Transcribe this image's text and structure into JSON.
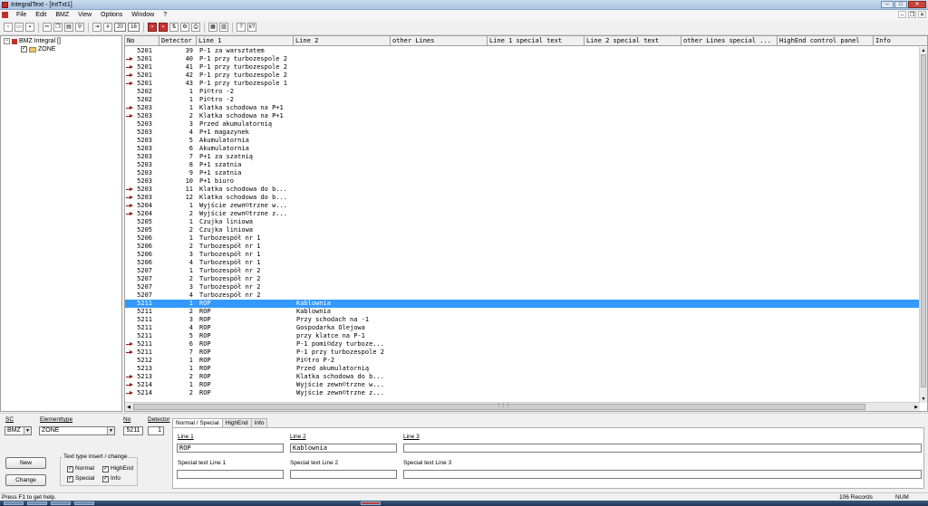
{
  "window": {
    "title": "IntegralText - [IntTxt1]"
  },
  "menu": [
    "File",
    "Edit",
    "BMZ",
    "View",
    "Options",
    "Window",
    "?"
  ],
  "toolbar": {
    "field1": "20",
    "field2": "16"
  },
  "tree": {
    "root": "BMZ Integral []",
    "child": "ZONE"
  },
  "grid": {
    "columns": [
      "No",
      "Detector",
      "Line 1",
      "Line 2",
      "other Lines",
      "Line 1 special text",
      "Line 2 special text",
      "other Lines special ...",
      "HighEnd control panel",
      "Info"
    ],
    "rows": [
      {
        "no": "5201",
        "det": "39",
        "l1": "P-1 za warsztatem",
        "l2": "",
        "arrow": false
      },
      {
        "no": "5201",
        "det": "40",
        "l1": "P-1 przy turbozespole 2",
        "l2": "",
        "arrow": true
      },
      {
        "no": "5201",
        "det": "41",
        "l1": "P-1 przy turbozespole 2",
        "l2": "",
        "arrow": true
      },
      {
        "no": "5201",
        "det": "42",
        "l1": "P-1 przy turbozespole 2",
        "l2": "",
        "arrow": true
      },
      {
        "no": "5201",
        "det": "43",
        "l1": "P-1 przy turbozespole 1",
        "l2": "",
        "arrow": true
      },
      {
        "no": "5202",
        "det": "1",
        "l1": "Pi©tro -2",
        "l2": "",
        "arrow": false
      },
      {
        "no": "5202",
        "det": "1",
        "l1": "Pi©tro -2",
        "l2": "",
        "arrow": false
      },
      {
        "no": "5203",
        "det": "1",
        "l1": "Klatka schodowa na P+1",
        "l2": "",
        "arrow": true
      },
      {
        "no": "5203",
        "det": "2",
        "l1": "Klatka schodowa na P+1",
        "l2": "",
        "arrow": true
      },
      {
        "no": "5203",
        "det": "3",
        "l1": "Przed akumulatornią",
        "l2": "",
        "arrow": false
      },
      {
        "no": "5203",
        "det": "4",
        "l1": "P+1 magazynek",
        "l2": "",
        "arrow": false
      },
      {
        "no": "5203",
        "det": "5",
        "l1": "Akumulatornia",
        "l2": "",
        "arrow": false
      },
      {
        "no": "5203",
        "det": "6",
        "l1": "Akumulatornia",
        "l2": "",
        "arrow": false
      },
      {
        "no": "5203",
        "det": "7",
        "l1": "P+1 za szatnią",
        "l2": "",
        "arrow": false
      },
      {
        "no": "5203",
        "det": "8",
        "l1": "P+1 szatnia",
        "l2": "",
        "arrow": false
      },
      {
        "no": "5203",
        "det": "9",
        "l1": "P+1 szatnia",
        "l2": "",
        "arrow": false
      },
      {
        "no": "5203",
        "det": "10",
        "l1": "P+1 biuro",
        "l2": "",
        "arrow": false
      },
      {
        "no": "5203",
        "det": "11",
        "l1": "Klatka schodowa do b...",
        "l2": "",
        "arrow": true
      },
      {
        "no": "5203",
        "det": "12",
        "l1": "Klatka schodowa do b...",
        "l2": "",
        "arrow": true
      },
      {
        "no": "5204",
        "det": "1",
        "l1": "Wyjście zewn©trzne w...",
        "l2": "",
        "arrow": true
      },
      {
        "no": "5204",
        "det": "2",
        "l1": "Wyjście zewn©trzne z...",
        "l2": "",
        "arrow": true
      },
      {
        "no": "5205",
        "det": "1",
        "l1": "Czujka liniowa",
        "l2": "",
        "arrow": false
      },
      {
        "no": "5205",
        "det": "2",
        "l1": "Czujka liniowa",
        "l2": "",
        "arrow": false
      },
      {
        "no": "5206",
        "det": "1",
        "l1": "Turbozespół nr 1",
        "l2": "",
        "arrow": false
      },
      {
        "no": "5206",
        "det": "2",
        "l1": "Turbozespół nr 1",
        "l2": "",
        "arrow": false
      },
      {
        "no": "5206",
        "det": "3",
        "l1": "Turbozespół nr 1",
        "l2": "",
        "arrow": false
      },
      {
        "no": "5206",
        "det": "4",
        "l1": "Turbozespół nr 1",
        "l2": "",
        "arrow": false
      },
      {
        "no": "5207",
        "det": "1",
        "l1": "Turbozespół nr 2",
        "l2": "",
        "arrow": false
      },
      {
        "no": "5207",
        "det": "2",
        "l1": "Turbozespół nr 2",
        "l2": "",
        "arrow": false
      },
      {
        "no": "5207",
        "det": "3",
        "l1": "Turbozespół nr 2",
        "l2": "",
        "arrow": false
      },
      {
        "no": "5207",
        "det": "4",
        "l1": "Turbozespół nr 2",
        "l2": "",
        "arrow": false
      },
      {
        "no": "5211",
        "det": "1",
        "l1": "ROP",
        "l2": "Kablownia",
        "arrow": false,
        "selected": true
      },
      {
        "no": "5211",
        "det": "2",
        "l1": "ROP",
        "l2": "Kablownia",
        "arrow": false
      },
      {
        "no": "5211",
        "det": "3",
        "l1": "ROP",
        "l2": "Przy schodach na -1",
        "arrow": false
      },
      {
        "no": "5211",
        "det": "4",
        "l1": "ROP",
        "l2": "Gospodarka Olejowa",
        "arrow": false
      },
      {
        "no": "5211",
        "det": "5",
        "l1": "ROP",
        "l2": "przy klatce na P-1",
        "arrow": false
      },
      {
        "no": "5211",
        "det": "6",
        "l1": "ROP",
        "l2": "P-1 pomi©dzy turboze...",
        "arrow": true
      },
      {
        "no": "5211",
        "det": "7",
        "l1": "ROP",
        "l2": "P-1 przy turbozespole 2",
        "arrow": true
      },
      {
        "no": "5212",
        "det": "1",
        "l1": "ROP",
        "l2": "Pi©tro P-2",
        "arrow": false
      },
      {
        "no": "5213",
        "det": "1",
        "l1": "ROP",
        "l2": "Przed akumulatornią",
        "arrow": false
      },
      {
        "no": "5213",
        "det": "2",
        "l1": "ROP",
        "l2": "Klatka schodowa do b...",
        "arrow": true
      },
      {
        "no": "5214",
        "det": "1",
        "l1": "ROP",
        "l2": "Wyjście zewn©trzne w...",
        "arrow": true
      },
      {
        "no": "5214",
        "det": "2",
        "l1": "ROP",
        "l2": "Wyjście zewn©trzne z...",
        "arrow": true
      }
    ]
  },
  "form": {
    "sc_label": "SC",
    "sc_value": "BMZ",
    "elementtype_label": "Elementtype",
    "elementtype_value": "ZONE",
    "no_label": "No",
    "no_value": "5211",
    "detector_label": "Detector",
    "detector_value": "1",
    "new_button": "New",
    "change_button": "Change",
    "group_title": "Text type insert / change",
    "cb_normal": "Normal",
    "cb_highend": "HighEnd",
    "cb_special": "Special",
    "cb_info": "Info",
    "tabs": [
      "Normal / Special",
      "HighEnd",
      "Info"
    ],
    "line1_label": "Line 1",
    "line2_label": "Line 2",
    "line3_label": "Line 3",
    "line1_value": "ROP",
    "line2_value": "Kablownia",
    "line3_value": "",
    "sp1_label": "Special text   Line 1",
    "sp2_label": "Special text   Line 2",
    "sp3_label": "Special text   Line 3"
  },
  "status": {
    "help": "Press F1 to get help.",
    "records": "106 Records",
    "num": "NUM"
  }
}
